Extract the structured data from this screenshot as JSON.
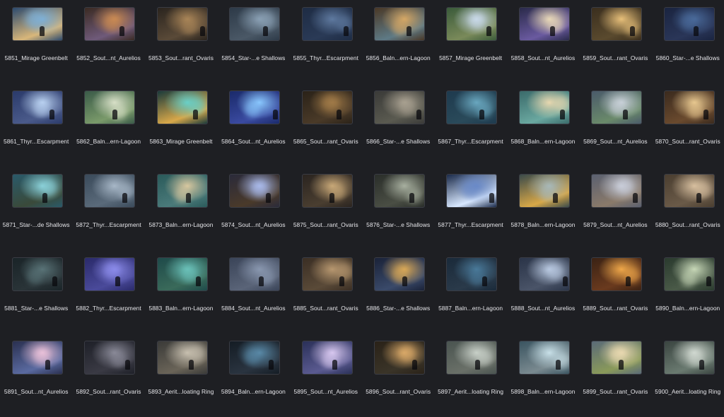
{
  "files": [
    {
      "name": "5851_Mirage Greenbelt",
      "palette": [
        "#2c4a6e",
        "#7fb0d6",
        "#d9b77a"
      ]
    },
    {
      "name": "5852_Sout...nt_Aurelios",
      "palette": [
        "#3a2a22",
        "#c98a54",
        "#6f5a7a"
      ]
    },
    {
      "name": "5853_Sout...rant_Ovaris",
      "palette": [
        "#2a241e",
        "#a98558",
        "#5a4a38"
      ]
    },
    {
      "name": "5854_Star-...e Shallows",
      "palette": [
        "#2d3a48",
        "#8aa0b4",
        "#4a5866"
      ]
    },
    {
      "name": "5855_Thyr...Escarpment",
      "palette": [
        "#1e2c44",
        "#5f7aa0",
        "#2a3a56"
      ]
    },
    {
      "name": "5856_Baln...ern-Lagoon",
      "palette": [
        "#4a3826",
        "#d6a866",
        "#5e7a86"
      ]
    },
    {
      "name": "5857_Mirage Greenbelt",
      "palette": [
        "#3a5a3a",
        "#c8d8e8",
        "#7a8a5a"
      ]
    },
    {
      "name": "5858_Sout...nt_Aurelios",
      "palette": [
        "#2a2a4a",
        "#e8d8b8",
        "#6a5aa0"
      ]
    },
    {
      "name": "5859_Sout...rant_Ovaris",
      "palette": [
        "#3a2e1e",
        "#e8c07a",
        "#5a4a2e"
      ]
    },
    {
      "name": "5860_Star-...e Shallows",
      "palette": [
        "#1a2440",
        "#4a6a9a",
        "#2a3658"
      ]
    },
    {
      "name": "5861_Thyr...Escarpment",
      "palette": [
        "#2a3a6a",
        "#b8d0f0",
        "#4a5a8a"
      ]
    },
    {
      "name": "5862_Baln...ern-Lagoon",
      "palette": [
        "#3a5a48",
        "#d8e0c8",
        "#7a9a6a"
      ]
    },
    {
      "name": "5863_Mirage Greenbelt",
      "palette": [
        "#1a3a3a",
        "#6ad0c8",
        "#d8a84a"
      ]
    },
    {
      "name": "5864_Sout...nt_Aurelios",
      "palette": [
        "#1a2a6a",
        "#8ac8ff",
        "#3a4aa0"
      ]
    },
    {
      "name": "5865_Sout...rant_Ovaris",
      "palette": [
        "#2a2218",
        "#a07a48",
        "#4a3a28"
      ]
    },
    {
      "name": "5866_Star-...e Shallows",
      "palette": [
        "#3a3a38",
        "#a8a090",
        "#5a5a50"
      ]
    },
    {
      "name": "5867_Thyr...Escarpment",
      "palette": [
        "#1e3a4e",
        "#6aa8c0",
        "#2a4a5a"
      ]
    },
    {
      "name": "5868_Baln...ern-Lagoon",
      "palette": [
        "#3a6a6a",
        "#e8d8b0",
        "#6aa8a0"
      ]
    },
    {
      "name": "5869_Sout...nt_Aurelios",
      "palette": [
        "#4a5a6a",
        "#c8d0d8",
        "#6a8a6a"
      ]
    },
    {
      "name": "5870_Sout...rant_Ovaris",
      "palette": [
        "#3a2a1e",
        "#e8c890",
        "#6a4a2e"
      ]
    },
    {
      "name": "5871_Star-...de Shallows",
      "palette": [
        "#2a5a6a",
        "#8ad0d8",
        "#3a4a3a"
      ]
    },
    {
      "name": "5872_Thyr...Escarpment",
      "palette": [
        "#3a4a5a",
        "#a8b8c8",
        "#5a6a7a"
      ]
    },
    {
      "name": "5873_Baln...ern-Lagoon",
      "palette": [
        "#2a5a5a",
        "#d8c8a0",
        "#4a7a7a"
      ]
    },
    {
      "name": "5874_Sout...nt_Aurelios",
      "palette": [
        "#2a2a3a",
        "#a8b8e8",
        "#4a3a2a"
      ]
    },
    {
      "name": "5875_Sout...rant_Ovaris",
      "palette": [
        "#2a2420",
        "#c8a878",
        "#4a3e30"
      ]
    },
    {
      "name": "5876_Star-...e Shallows",
      "palette": [
        "#2a2e2a",
        "#a8b0a0",
        "#4a4e44"
      ]
    },
    {
      "name": "5877_Thyr...Escarpment",
      "palette": [
        "#1a2a4a",
        "#6a8ac8",
        "#d8e8ff"
      ]
    },
    {
      "name": "5878_Baln...ern-Lagoon",
      "palette": [
        "#3a4a4a",
        "#a8b8b8",
        "#d8a848"
      ]
    },
    {
      "name": "5879_Sout...nt_Aurelios",
      "palette": [
        "#5a6070",
        "#c8ccd8",
        "#8a7a6a"
      ]
    },
    {
      "name": "5880_Sout...rant_Ovaris",
      "palette": [
        "#4a3e30",
        "#d8c0a0",
        "#6a5a48"
      ]
    },
    {
      "name": "5881_Star-...e Shallows",
      "palette": [
        "#1a2428",
        "#5a7478",
        "#2a3438"
      ]
    },
    {
      "name": "5882_Thyr...Escarpment",
      "palette": [
        "#2a2a6a",
        "#8a8ae8",
        "#4a4a9a"
      ]
    },
    {
      "name": "5883_Baln...ern-Lagoon",
      "palette": [
        "#1e4a4a",
        "#6ac0b8",
        "#3a6a5a"
      ]
    },
    {
      "name": "5884_Sout...nt_Aurelios",
      "palette": [
        "#3a4458",
        "#8a98b0",
        "#5a6478"
      ]
    },
    {
      "name": "5885_Sout...rant_Ovaris",
      "palette": [
        "#3a2e24",
        "#b89870",
        "#5a4a38"
      ]
    },
    {
      "name": "5886_Star-...e Shallows",
      "palette": [
        "#1a2238",
        "#d8a858",
        "#3a4a6a"
      ]
    },
    {
      "name": "5887_Baln...ern-Lagoon",
      "palette": [
        "#1a2a3a",
        "#4a7a9a",
        "#2a3a4a"
      ]
    },
    {
      "name": "5888_Sout...nt_Aurelios",
      "palette": [
        "#2a3448",
        "#b8c8e0",
        "#4a5468"
      ]
    },
    {
      "name": "5889_Sout...rant_Ovaris",
      "palette": [
        "#3a2214",
        "#f0a84a",
        "#6a3a1e"
      ]
    },
    {
      "name": "5890_Baln...ern-Lagoon",
      "palette": [
        "#2a3a2e",
        "#c8d8b8",
        "#4a5a48"
      ]
    },
    {
      "name": "5891_Sout...nt_Aurelios",
      "palette": [
        "#2a3050",
        "#e8c0d8",
        "#5a6aa0"
      ]
    },
    {
      "name": "5892_Sout...rant_Ovaris",
      "palette": [
        "#1e2028",
        "#8a8a98",
        "#3a3a44"
      ]
    },
    {
      "name": "5893_Aerit...loating Ring",
      "palette": [
        "#3a3a38",
        "#c8c0b0",
        "#6a6458"
      ]
    },
    {
      "name": "5894_Baln...ern-Lagoon",
      "palette": [
        "#141c24",
        "#5a8aa8",
        "#2a3440"
      ]
    },
    {
      "name": "5895_Sout...nt_Aurelios",
      "palette": [
        "#2a3058",
        "#d8c8f0",
        "#5a5a90"
      ]
    },
    {
      "name": "5896_Sout...rant_Ovaris",
      "palette": [
        "#2a2218",
        "#d8a868",
        "#3a3428"
      ]
    },
    {
      "name": "5897_Aerit...loating Ring",
      "palette": [
        "#4a5450",
        "#c8d0c8",
        "#6a7068"
      ]
    },
    {
      "name": "5898_Baln...ern-Lagoon",
      "palette": [
        "#3a5460",
        "#c8e0e8",
        "#7a8a90"
      ]
    },
    {
      "name": "5899_Sout...rant_Ovaris",
      "palette": [
        "#5a6a78",
        "#e8d8b0",
        "#8a9a5a"
      ]
    },
    {
      "name": "5900_Aerit...loating Ring",
      "palette": [
        "#3a4440",
        "#d0d8d0",
        "#6a7a70"
      ]
    }
  ]
}
